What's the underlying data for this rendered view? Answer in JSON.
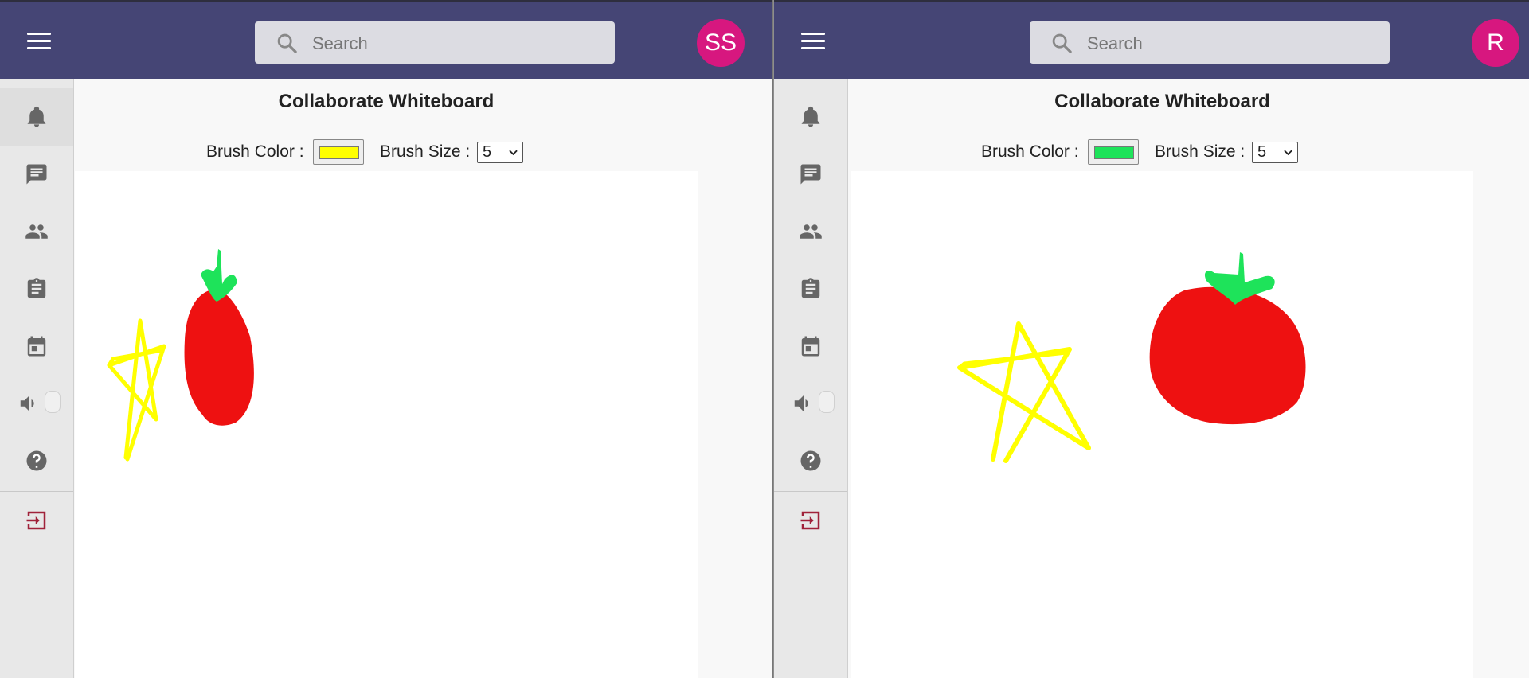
{
  "colors": {
    "header_bg": "#454575",
    "avatar_bg": "#d7177f",
    "sidebar_bg": "#e8e8e8",
    "exit_icon": "#a0223a",
    "brush_yellow": "#ffff00",
    "brush_green": "#1ee35a",
    "drawing_red": "#ee1111"
  },
  "panels": [
    {
      "header": {
        "search_placeholder": "Search",
        "avatar_initials": "SS"
      },
      "sidebar": {
        "items": [
          "bell-icon",
          "chat-icon",
          "people-icon",
          "clipboard-icon",
          "calendar-icon",
          "volume-icon",
          "help-icon",
          "exit-icon"
        ],
        "active": "bell-icon"
      },
      "whiteboard": {
        "title": "Collaborate Whiteboard",
        "brush_color_label": "Brush Color :",
        "brush_color": "#ffff00",
        "brush_size_label": "Brush Size :",
        "brush_size": "5"
      }
    },
    {
      "header": {
        "search_placeholder": "Search",
        "avatar_initials": "R"
      },
      "sidebar": {
        "items": [
          "bell-icon",
          "chat-icon",
          "people-icon",
          "clipboard-icon",
          "calendar-icon",
          "volume-icon",
          "help-icon",
          "exit-icon"
        ],
        "active": ""
      },
      "whiteboard": {
        "title": "Collaborate Whiteboard",
        "brush_color_label": "Brush Color :",
        "brush_color": "#1ee35a",
        "brush_size_label": "Brush Size :",
        "brush_size": "5"
      }
    }
  ]
}
